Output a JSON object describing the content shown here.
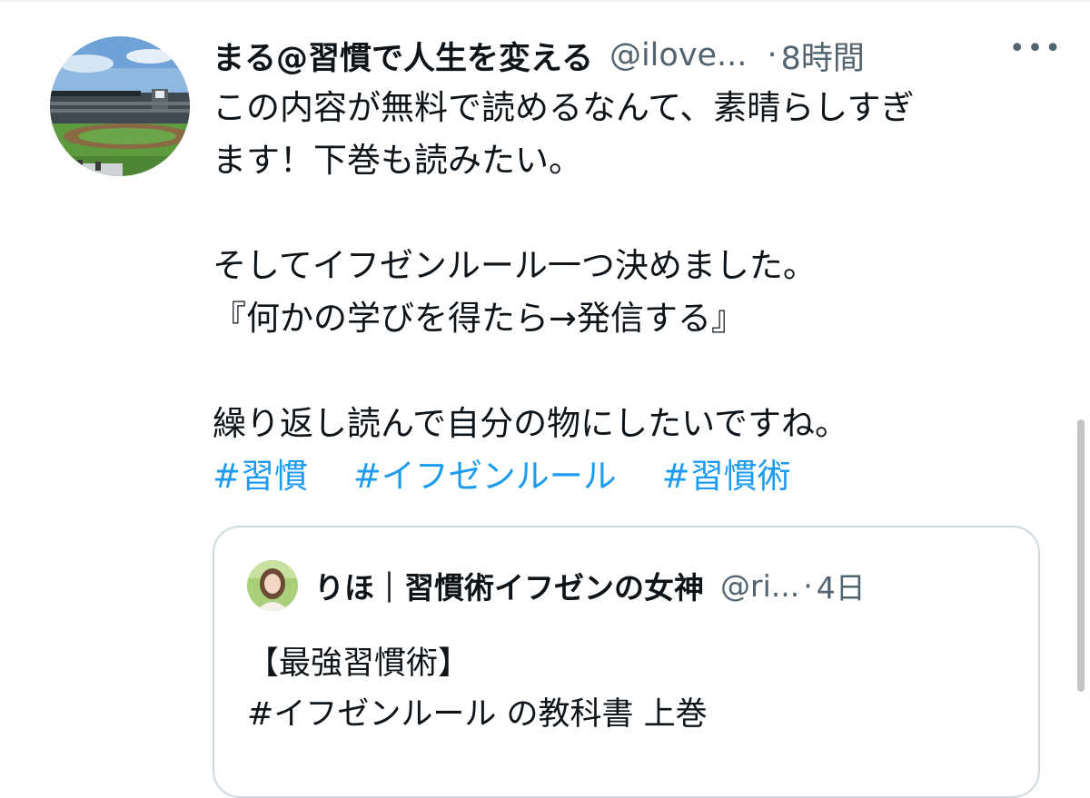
{
  "tweet": {
    "display_name": "まる@習慣で人生を変える",
    "handle": "@ilove...",
    "separator": "·",
    "time": "8時間",
    "more": "•••",
    "lines": [
      "この内容が無料で読めるなんて、素晴らしすぎ",
      "ます！下巻も読みたい。",
      "",
      "そしてイフゼンルール一つ決めました。",
      "『何かの学びを得たら→発信する』",
      "",
      "繰り返し読んで自分の物にしたいですね。"
    ],
    "hashtags": [
      "#習慣",
      "#イフゼンルール",
      "#習慣術"
    ]
  },
  "quote": {
    "display_name": "りほ｜習慣術イフゼンの女神",
    "handle": "@ri...",
    "separator": "·",
    "time": "4日",
    "lines": [
      "【最強習慣術】",
      "#イフゼンルール の教科書 上巻"
    ]
  },
  "icons": {
    "avatar": "avatar-baseball-stadium",
    "quote_avatar": "avatar-woman-portrait",
    "more": "more-icon"
  },
  "colors": {
    "text": "#0f1419",
    "secondary": "#536471",
    "link": "#1d9bf0",
    "border": "#cfd9de"
  }
}
